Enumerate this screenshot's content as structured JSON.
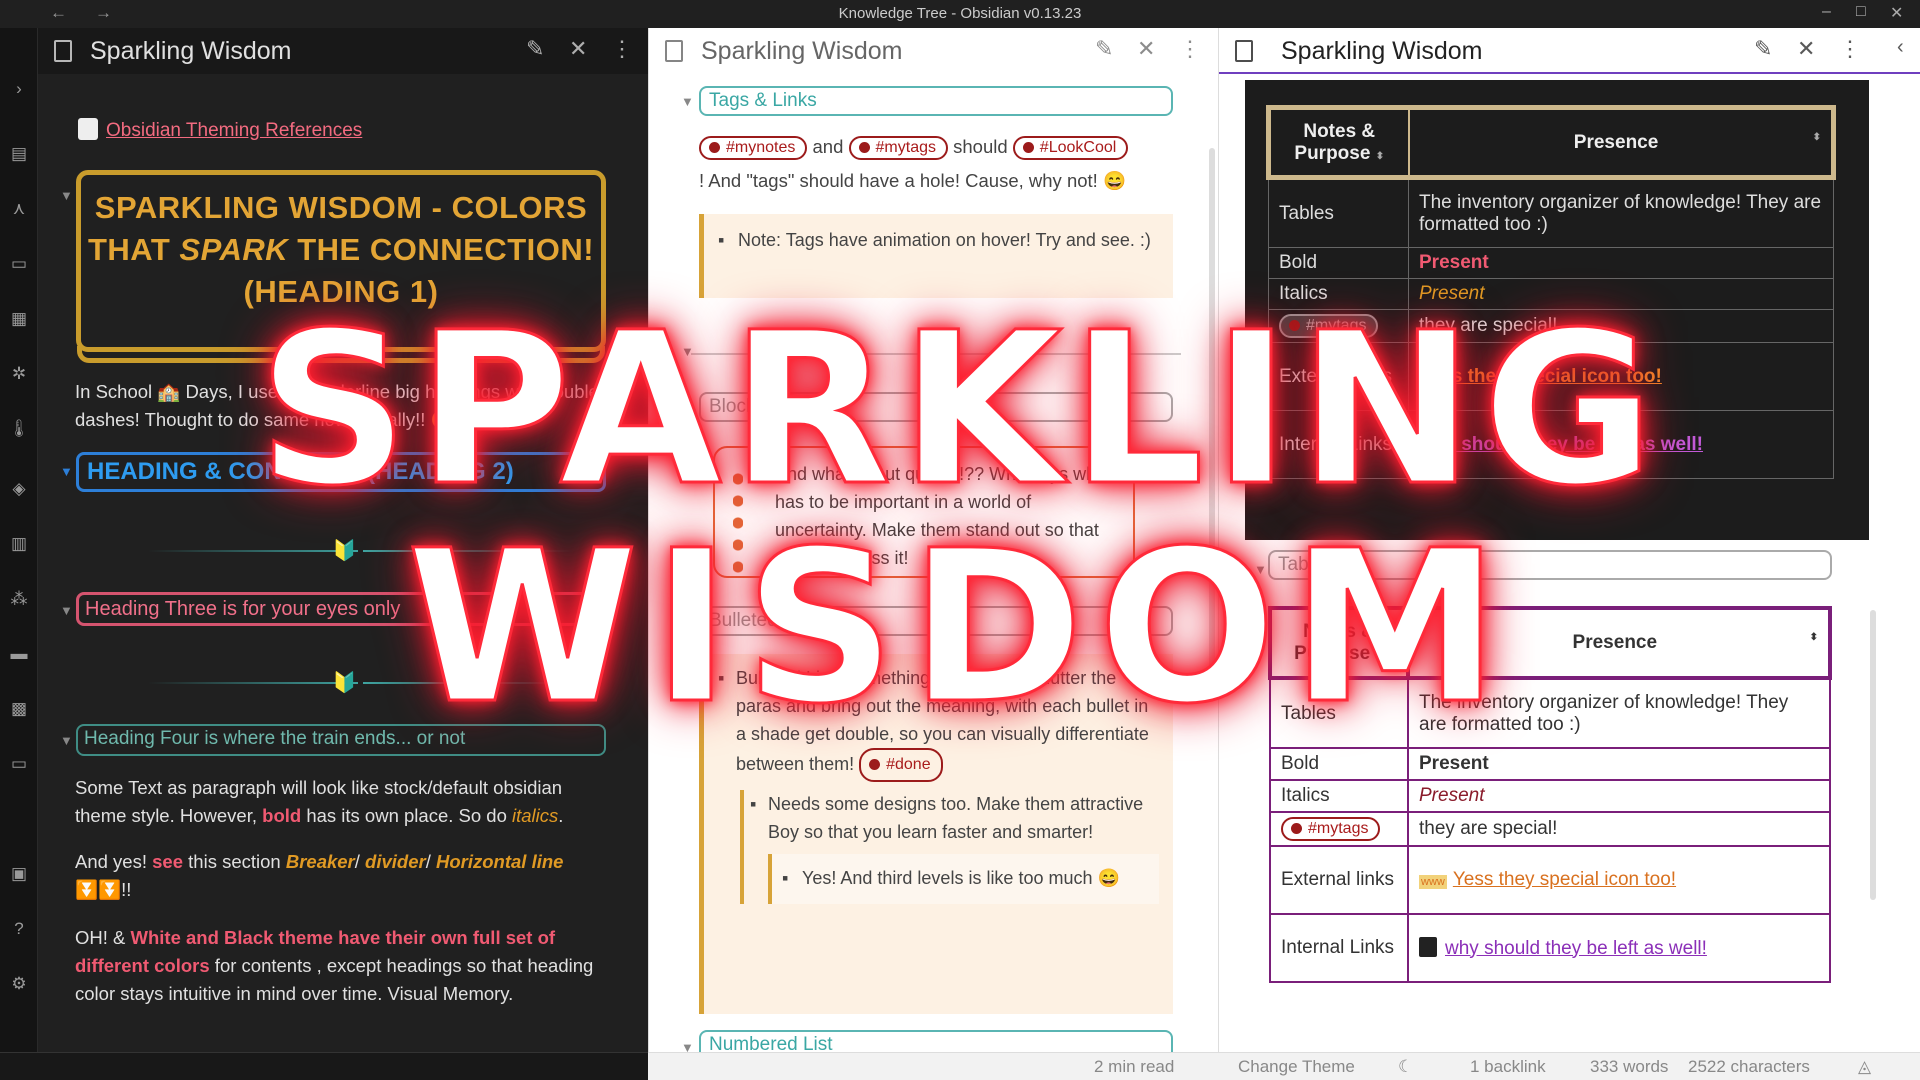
{
  "window": {
    "title": "Knowledge Tree - Obsidian v0.13.23",
    "minimize": "–",
    "maximize": "□",
    "close": "✕",
    "back": "←",
    "forward": "→"
  },
  "panes": {
    "tab_title": "Sparkling Wisdom"
  },
  "dark": {
    "ref_link": "Obsidian Theming References",
    "h1_line1": "SPARKLING WISDOM - COLORS",
    "h1_line2a": "THAT ",
    "h1_line2b": "SPARK",
    "h1_line2c": " THE CONNECTION!",
    "h1_line3": "(HEADING 1)",
    "school_text": "In School 🏫 Days, I used to underline big headings with double dashes! Thought to do same now digitally!! 😉",
    "h2": "HEADING & CONTENTS (HEADING 2)",
    "h3": "Heading Three is for your eyes only",
    "h4": "Heading Four is where the train ends... or not",
    "p1a": "Some Text as paragraph will look like stock/default obsidian theme style. However, ",
    "p1_bold": "bold",
    "p1b": " has its own place. So do ",
    "p1_italic": "italics",
    "p1c": ".",
    "p2a": "And yes! ",
    "p2_see": "see",
    "p2b": " this section ",
    "p2_i1": "Breaker",
    "p2_i2": "divider",
    "p2_i3": "Horizontal line",
    "p2_end": "⏬⏬!!",
    "p3a": "OH! & ",
    "p3_bold": "White and Black theme have their own full set of different colors",
    "p3b": " for contents , except headings so that heading color stays intuitive in mind over time. Visual Memory."
  },
  "mid": {
    "tags_heading": "Tags & Links",
    "tag1": "#mynotes",
    "and": "and",
    "tag2": "#mytags",
    "should": "should",
    "tag3": "#LookCool",
    "tags_line2": "! And \"tags\" should have a hole! Cause, why not! 😄",
    "note": "Note: Tags have animation on hover! Try and see. :)",
    "blockquote_heading": "Blockquote",
    "quote": "And what about quotes!?? Who says what has to be important in a world of uncertainty. Make them stand out so that you don't miss it!",
    "bullet_heading": "Bulleted List",
    "bullet1": "Bulleted List: Something we use to declutter the paras and bring out the meaning, with each bullet in a shade get double, so you can visually differentiate between them!",
    "done_tag": "#done",
    "bullet2": "Needs some designs too. Make them attractive Boy so that you learn faster and smarter!",
    "bullet3": "Yes! And third levels is like too much 😄",
    "numbered_heading": "Numbered List"
  },
  "right": {
    "col1": "Notes & Purpose",
    "col2": "Presence",
    "rows": [
      {
        "k": "Tables",
        "v": "The inventory organizer of knowledge! They are formatted too :)"
      },
      {
        "k": "Bold",
        "v": "Present"
      },
      {
        "k": "Italics",
        "v": "Present"
      },
      {
        "k": "#mytags",
        "v": "they are special!"
      },
      {
        "k": "External links",
        "v": "Yess they special icon too!"
      },
      {
        "k": "Internal Links",
        "v": "why should they be left as well!"
      }
    ],
    "tables_heading": "Tables",
    "www": "www"
  },
  "status": {
    "read": "2 min read",
    "theme": "Change Theme",
    "backlinks": "1 backlink",
    "words": "333 words",
    "chars": "2522 characters"
  },
  "overlay": {
    "line1": "SPARKLING",
    "line2": "WISDOM"
  },
  "colors": {
    "gold": "#c99c2c",
    "blue": "#2d7fd8",
    "pink": "#d5546f",
    "teal": "#3f8d85",
    "tag_red": "#9c1b1b",
    "purple": "#7a1f7a",
    "neon": "#ff2a3a"
  }
}
